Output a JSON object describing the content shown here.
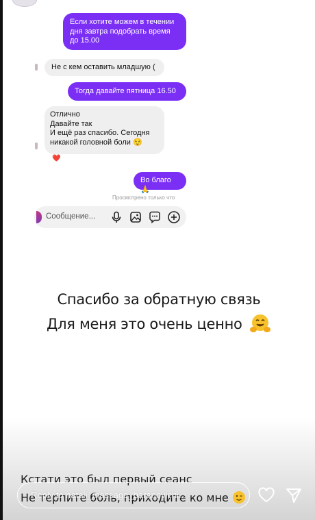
{
  "messages": [
    {
      "dir": "out",
      "text": "Если хотите можем в течении\nдня завтра подобрать время\nдо 15.00"
    },
    {
      "dir": "in",
      "text": "Не с кем оставить младшую ("
    },
    {
      "dir": "out",
      "text": "Тогда давайте пятница 16.50"
    },
    {
      "dir": "in",
      "text": "Отлично\nДавайте так\nИ ещё раз спасибо. Сегодня\nникакой головной боли 😌"
    },
    {
      "dir": "out",
      "text": "Во благо🙏"
    }
  ],
  "reaction": "❤️",
  "seen_label": "Просмотрено только что",
  "composer": {
    "placeholder": "Сообщение..."
  },
  "caption": {
    "line1": "Спасибо за обратную связь",
    "line2": "Для меня это очень ценно"
  },
  "bottom_text": {
    "line1": "Кстати это был первый сеанс",
    "line2": "Не терпите боль, приходите ко мне"
  },
  "reply": {
    "placeholder": "Reply to natali_massage_baranovichi..."
  },
  "icons": [
    "heart-icon",
    "send-icon",
    "mic-icon",
    "gallery-icon",
    "sticker-icon",
    "add-icon",
    "hug-emoji-icon",
    "wink-emoji-icon"
  ],
  "colors": {
    "accent": "#7b2ff5",
    "incoming": "#efefef",
    "heart": "#e3342f"
  }
}
